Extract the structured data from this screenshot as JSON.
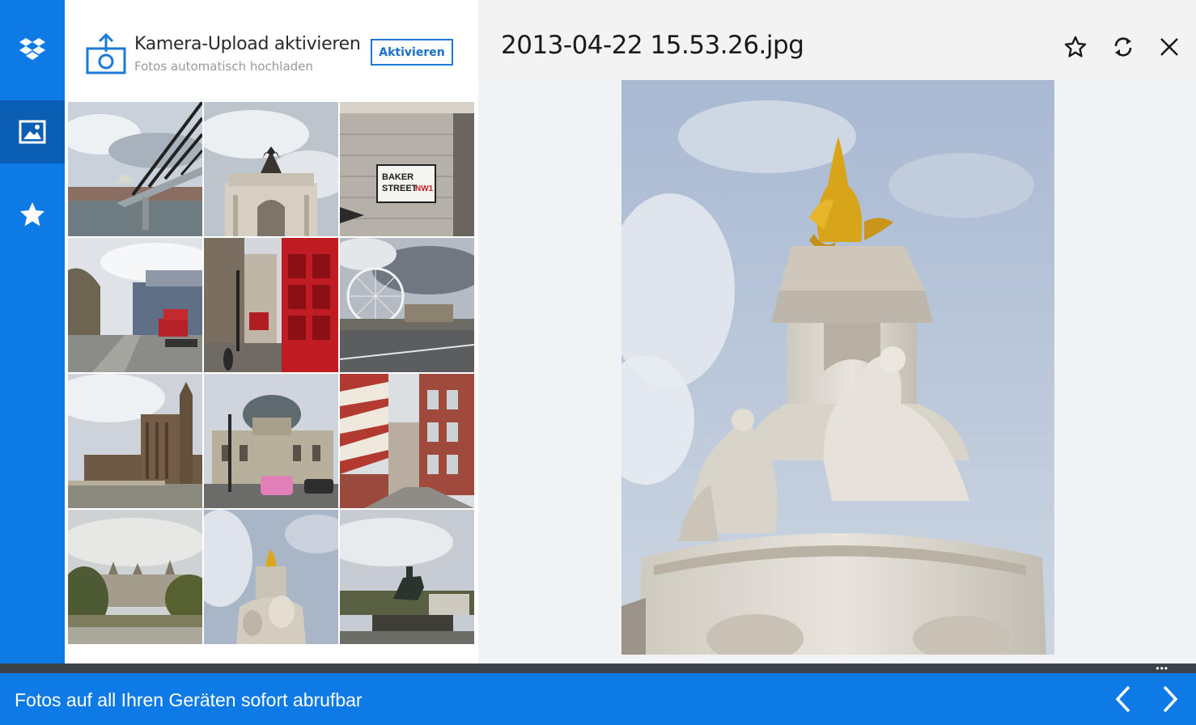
{
  "sidebar": {
    "items": [
      {
        "icon": "dropbox-logo-icon",
        "active": false
      },
      {
        "icon": "photos-icon",
        "active": true
      },
      {
        "icon": "favorites-star-icon",
        "active": false
      }
    ],
    "accent": "#0d7ae6"
  },
  "upload_banner": {
    "title": "Kamera-Upload aktivieren",
    "subtitle": "Fotos automatisch hochladen",
    "button_label": "Aktivieren",
    "icon": "camera-upload-icon"
  },
  "thumbnails": [
    {
      "subject": "millennium-bridge"
    },
    {
      "subject": "wellington-arch"
    },
    {
      "subject": "baker-street-sign",
      "sign_line1": "BAKER",
      "sign_line2": "STREET",
      "sign_suffix": "NW1"
    },
    {
      "subject": "london-street"
    },
    {
      "subject": "red-phone-box"
    },
    {
      "subject": "london-eye"
    },
    {
      "subject": "houses-of-parliament"
    },
    {
      "subject": "westminster-hall-taxi"
    },
    {
      "subject": "striped-street"
    },
    {
      "subject": "st-james-park"
    },
    {
      "subject": "victoria-memorial"
    },
    {
      "subject": "equestrian-statue"
    }
  ],
  "viewer": {
    "file_name": "2013-04-22 15.53.26.jpg",
    "actions": [
      {
        "icon": "star-outline-icon"
      },
      {
        "icon": "refresh-icon"
      },
      {
        "icon": "close-icon"
      }
    ]
  },
  "app_bar": {
    "message": "Fotos auf all Ihren Geräten sofort abrufbar",
    "more_label": "•••",
    "prev_icon": "chevron-left-icon",
    "next_icon": "chevron-right-icon"
  }
}
